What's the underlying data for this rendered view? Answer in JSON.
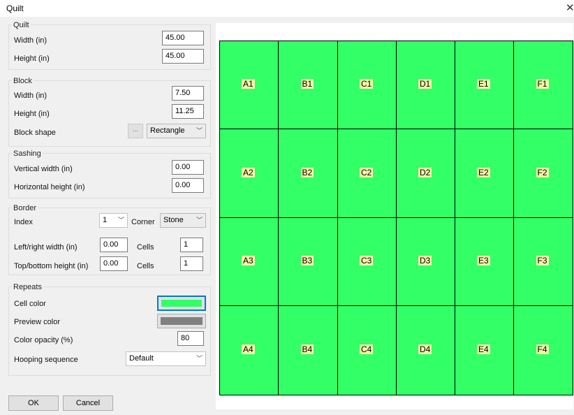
{
  "window": {
    "title": "Quilt",
    "close_glyph": "✕"
  },
  "quilt": {
    "group_label": "Quilt",
    "width_label": "Width (in)",
    "width_value": "45.00",
    "height_label": "Height (in)",
    "height_value": "45.00"
  },
  "block": {
    "group_label": "Block",
    "width_label": "Width (in)",
    "width_value": "7.50",
    "height_label": "Height (in)",
    "height_value": "11.25",
    "shape_label": "Block shape",
    "shape_dots": "...",
    "shape_value": "Rectangle"
  },
  "sashing": {
    "group_label": "Sashing",
    "vertical_label": "Vertical width (in)",
    "vertical_value": "0.00",
    "horizontal_label": "Horizontal height (in)",
    "horizontal_value": "0.00"
  },
  "border": {
    "group_label": "Border",
    "index_label": "Index",
    "index_value": "1",
    "corner_label": "Corner",
    "corner_value": "Stone",
    "lr_label": "Left/right width (in)",
    "lr_value": "0.00",
    "lr_cells_label": "Cells",
    "lr_cells_value": "1",
    "tb_label": "Top/bottom height (in)",
    "tb_value": "0.00",
    "tb_cells_label": "Cells",
    "tb_cells_value": "1"
  },
  "repeats": {
    "group_label": "Repeats",
    "cell_color_label": "Cell color",
    "cell_color": "#33ff66",
    "preview_color_label": "Preview color",
    "preview_color": "#808080",
    "opacity_label": "Color opacity (%)",
    "opacity_value": "80",
    "hooping_label": "Hooping sequence",
    "hooping_value": "Default"
  },
  "buttons": {
    "ok": "OK",
    "cancel": "Cancel"
  },
  "preview": {
    "fill_color": "#33ff66",
    "columns": [
      "A",
      "B",
      "C",
      "D",
      "E",
      "F"
    ],
    "rows": [
      "1",
      "2",
      "3",
      "4"
    ]
  }
}
